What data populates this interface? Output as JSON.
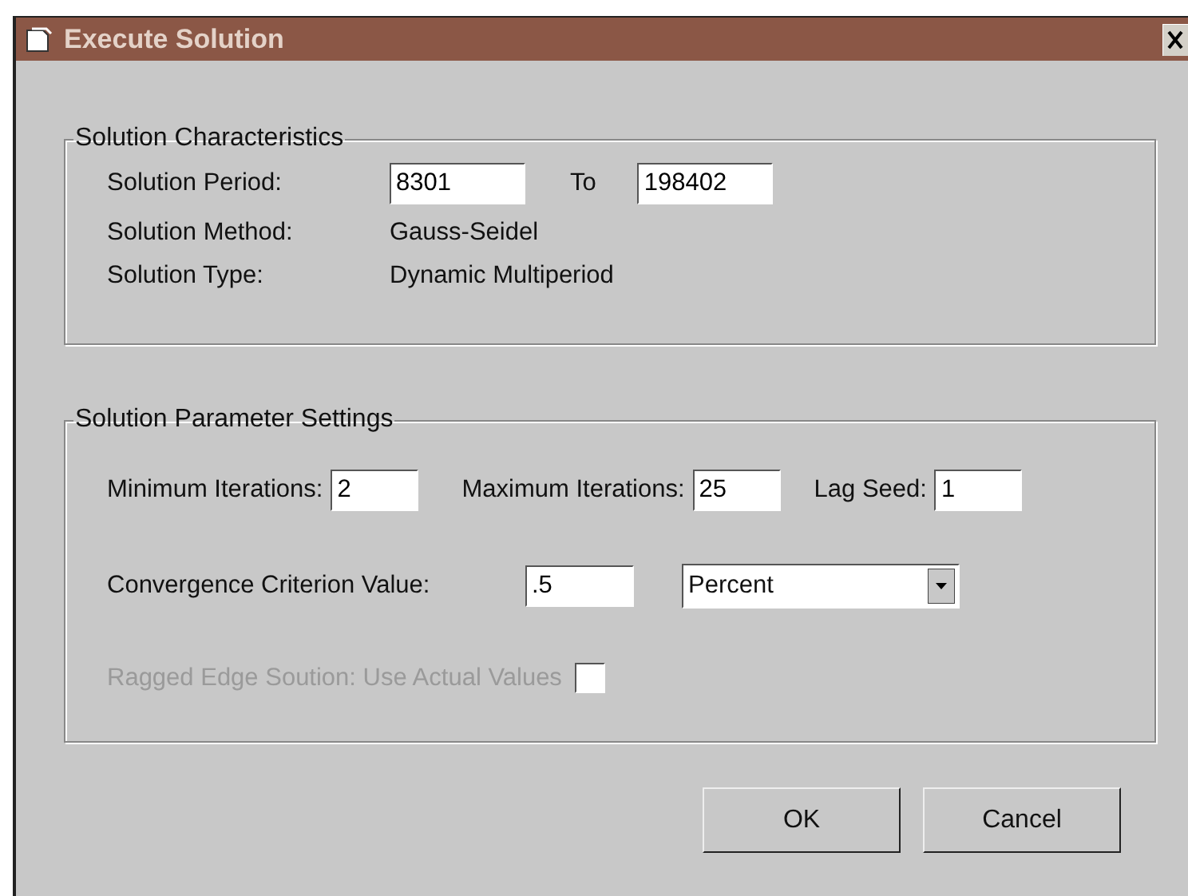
{
  "window": {
    "title": "Execute Solution"
  },
  "characteristics": {
    "title": "Solution Characteristics",
    "period": {
      "label": "Solution Period:",
      "from": "8301",
      "to_label": "To",
      "to": "198402"
    },
    "method": {
      "label": "Solution Method:",
      "value": "Gauss-Seidel"
    },
    "type": {
      "label": "Solution Type:",
      "value": "Dynamic Multiperiod"
    }
  },
  "parameters": {
    "title": "Solution Parameter Settings",
    "iterations": [
      {
        "label": "Minimum Iterations:",
        "value": "2"
      },
      {
        "label": "Maximum Iterations:",
        "value": "25"
      },
      {
        "label": "Lag Seed:",
        "value": "1"
      }
    ],
    "convergence": {
      "label": "Convergence Criterion Value:",
      "value": ".5",
      "unit": "Percent"
    },
    "ragged_edge": {
      "label": "Ragged Edge Soution: Use Actual Values",
      "checked": false,
      "disabled": true
    }
  },
  "buttons": [
    "OK",
    "Cancel"
  ]
}
